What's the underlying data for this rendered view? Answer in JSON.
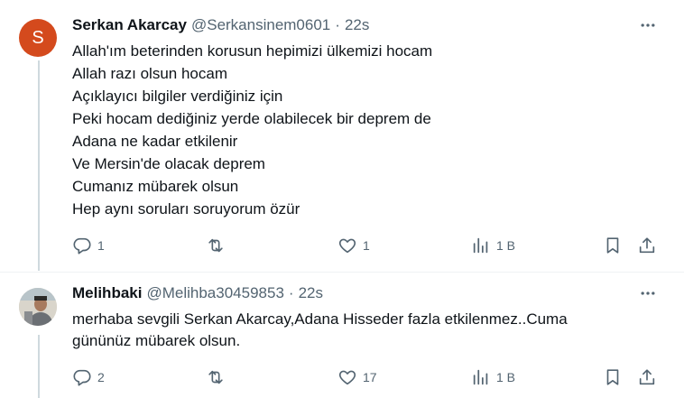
{
  "tweets": [
    {
      "avatar_letter": "S",
      "display_name": "Serkan Akarcay",
      "handle": "@Serkansinem0601",
      "separator": "·",
      "time": "22s",
      "lines": [
        "Allah'ım beterinden korusun hepimizi ülkemizi hocam",
        "Allah razı olsun hocam",
        "Açıklayıcı bilgiler verdiğiniz için",
        "Peki hocam dediğiniz yerde olabilecek bir deprem de",
        "Adana ne kadar etkilenir",
        "Ve Mersin'de olacak deprem",
        "Cumanız mübarek olsun",
        "Hep aynı soruları soruyorum özür"
      ],
      "replies": "1",
      "reposts": "",
      "likes": "1",
      "views": "1 B"
    },
    {
      "avatar_letter": "",
      "display_name": "Melihbaki",
      "handle": "@Melihba30459853",
      "separator": "·",
      "time": "22s",
      "lines": [
        "merhaba sevgili Serkan Akarcay,Adana Hisseder fazla etkilenmez..Cuma",
        "gününüz mübarek olsun."
      ],
      "replies": "2",
      "reposts": "",
      "likes": "17",
      "views": "1 B"
    }
  ],
  "colors": {
    "secondary_text": "#536471",
    "primary_text": "#0f1419",
    "avatar_s": "#d44a1d",
    "thread_line": "#cfd9de"
  },
  "icons": [
    "reply-icon",
    "repost-icon",
    "like-icon",
    "views-icon",
    "bookmark-icon",
    "share-icon",
    "more-icon"
  ]
}
